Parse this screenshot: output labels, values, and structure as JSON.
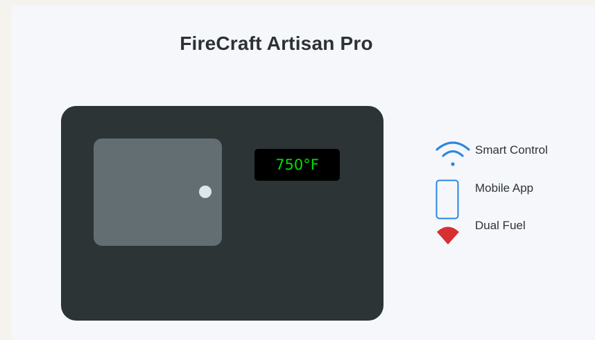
{
  "title": "FireCraft Artisan Pro",
  "display": {
    "temperature": "750°F",
    "text_color": "#00e000"
  },
  "features": [
    {
      "label": "Smart Control",
      "icon": "wifi-icon",
      "color": "#2e86de"
    },
    {
      "label": "Mobile App",
      "icon": "phone-icon",
      "color": "#2e86de"
    },
    {
      "label": "Dual Fuel",
      "icon": "fire-icon",
      "color": "#d63031"
    }
  ],
  "colors": {
    "oven_body": "#2d3436",
    "oven_door": "#636e72",
    "accent_blue": "#2e86de",
    "accent_red": "#d63031"
  }
}
